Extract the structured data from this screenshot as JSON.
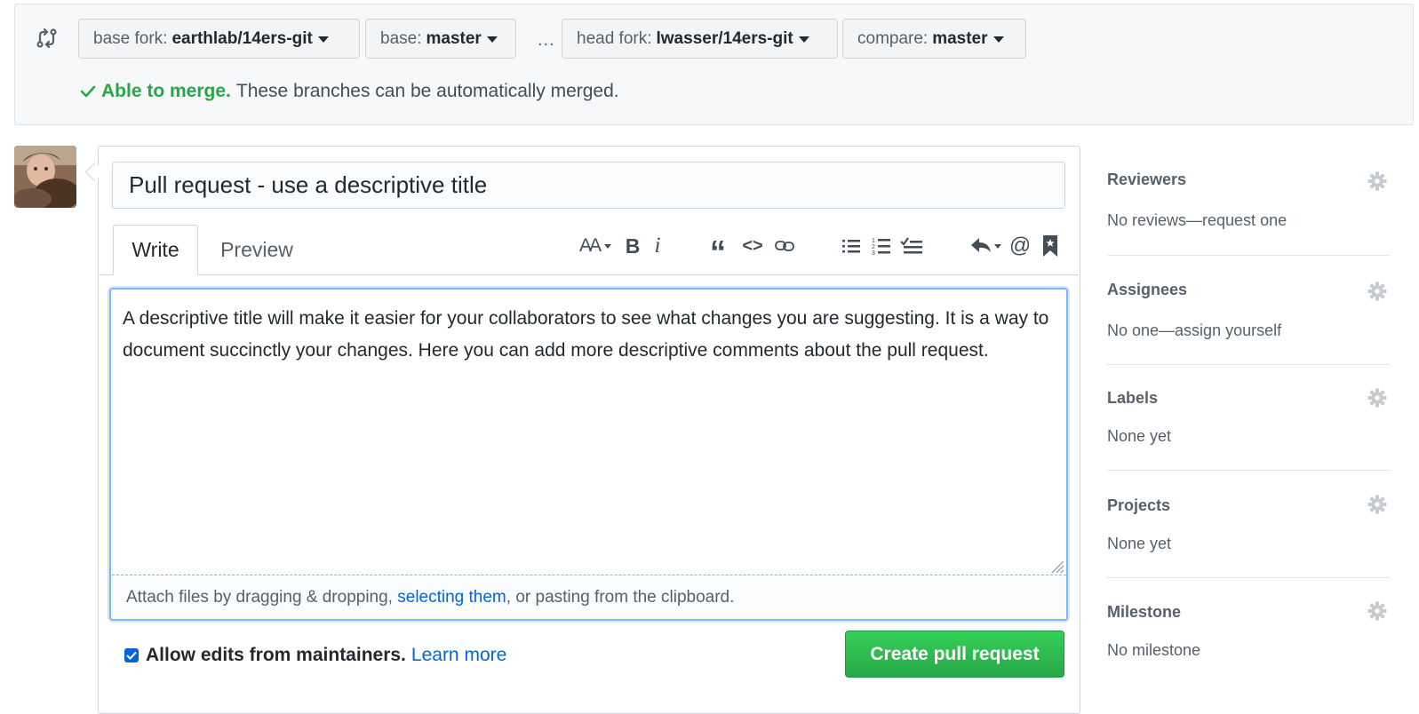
{
  "compare": {
    "base_fork_label": "base fork:",
    "base_fork_value": "earthlab/14ers-git",
    "base_label": "base:",
    "base_value": "master",
    "dots": "...",
    "head_fork_label": "head fork:",
    "head_fork_value": "lwasser/14ers-git",
    "compare_label": "compare:",
    "compare_value": "master",
    "merge_ok": "Able to merge.",
    "merge_text": "These branches can be automatically merged."
  },
  "form": {
    "title_value": "Pull request - use a descriptive title",
    "tabs": {
      "write": "Write",
      "preview": "Preview"
    },
    "toolbar": {
      "heading": "AA",
      "bold": "B",
      "italic": "i",
      "quote": "“",
      "code": "<>",
      "mention": "@"
    },
    "body": "A descriptive title will make it easier for your collaborators to see what changes you are suggesting. It is a way to document succinctly your changes. Here you can add more descriptive comments about the pull request.",
    "attach_prefix": "Attach files by dragging & dropping, ",
    "attach_link": "selecting them",
    "attach_suffix": ", or pasting from the clipboard.",
    "allow_edits_label": "Allow edits from maintainers.",
    "learn_more": "Learn more",
    "create_button": "Create pull request"
  },
  "sidebar": {
    "reviewers_title": "Reviewers",
    "reviewers_text": "No reviews—request one",
    "assignees_title": "Assignees",
    "assignees_text": "No one—assign yourself",
    "labels_title": "Labels",
    "labels_text": "None yet",
    "projects_title": "Projects",
    "projects_text": "None yet",
    "milestone_title": "Milestone",
    "milestone_text": "No milestone"
  },
  "colors": {
    "success_green": "#28a745",
    "link_blue": "#0366d6",
    "focus_blue": "#79b8ff"
  }
}
